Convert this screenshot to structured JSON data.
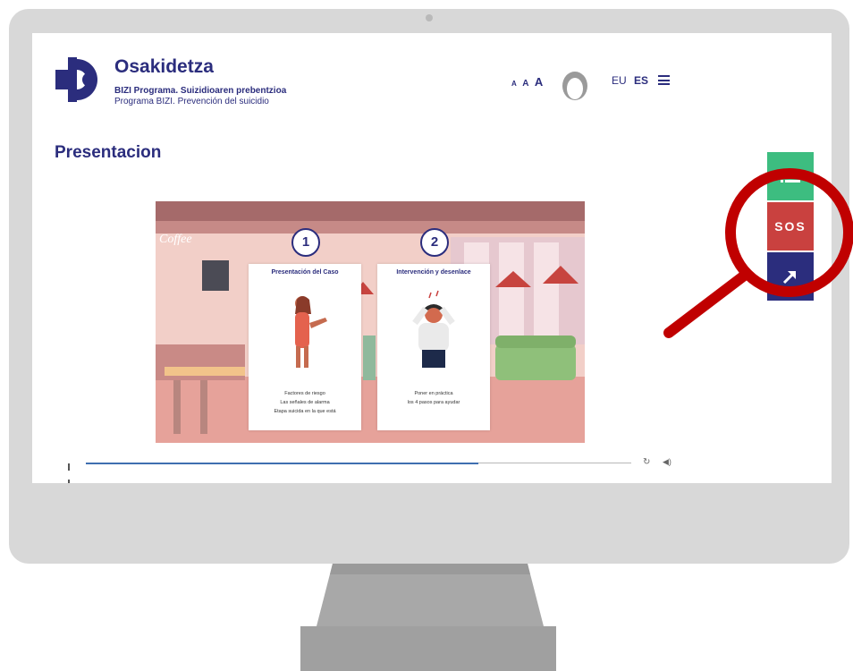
{
  "header": {
    "brand_title": "Osakidetza",
    "subtitle_eu": "BIZI Programa. Suizidioaren prebentzioa",
    "subtitle_es": "Programa BIZI. Prevención del suicidio",
    "font_size_small": "A",
    "font_size_mid": "A",
    "font_size_big": "A",
    "lang_eu": "EU",
    "lang_es": "ES",
    "active_language": "ES"
  },
  "page": {
    "title": "Presentacion"
  },
  "video": {
    "sign_text": "Coffee",
    "cards": [
      {
        "number": "1",
        "title": "Presentación del Caso",
        "lines": [
          "Factores de riesgo",
          "Las señales de alarma",
          "Etapa suicida en la que está"
        ]
      },
      {
        "number": "2",
        "title": "Intervención y desenlace",
        "lines": [
          "Poner en práctica",
          "los 4 pasos para ayudar"
        ]
      }
    ],
    "progress": 0.72
  },
  "side_buttons": {
    "sos_label": "SOS"
  },
  "colors": {
    "brand_navy": "#2b2d7d",
    "green": "#3dbd80",
    "sos_red": "#c9413f",
    "magnifier_red": "#c00000"
  },
  "icons": [
    "logo-icon",
    "avatar-icon",
    "menu-icon",
    "pause-icon",
    "replay-icon",
    "volume-icon",
    "list-icon",
    "arrow-up-right-icon",
    "magnifier-icon"
  ]
}
